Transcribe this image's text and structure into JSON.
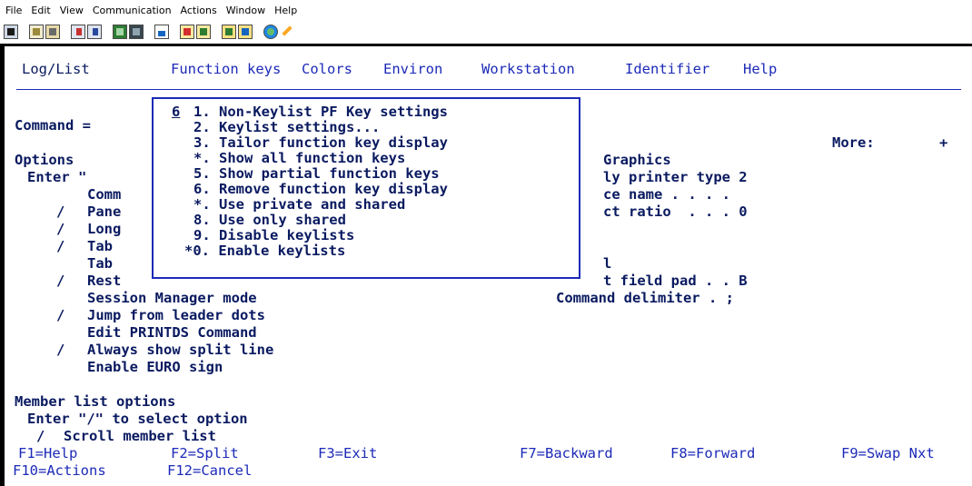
{
  "menubar": {
    "items": [
      "File",
      "Edit",
      "View",
      "Communication",
      "Actions",
      "Window",
      "Help"
    ]
  },
  "toolbar": {
    "icons": [
      "screen-icon",
      "copy-icon",
      "paste-icon",
      "send-icon",
      "receive-icon",
      "green-icon",
      "dark-icon",
      "chart-icon",
      "red-icon",
      "yellow-icon",
      "macro-record-icon",
      "macro-play-icon",
      "globe-icon",
      "pencil-icon"
    ]
  },
  "action_bar": {
    "items": [
      "Log/List",
      "Function keys",
      "Colors",
      "Environ",
      "Workstation",
      "Identifier",
      "Help"
    ]
  },
  "command_label": "Command =",
  "more_label": "More:",
  "more_indicator": "+",
  "options_label": "Options",
  "enter_partial": "Enter \"",
  "left_fragments": [
    "Comm",
    "Pane",
    "Long",
    "Tab",
    "Tab",
    "Rest"
  ],
  "left_markers": [
    "",
    "/",
    "/",
    "/",
    "",
    "/"
  ],
  "right_fragments": {
    "graphics": "Graphics",
    "printer": "ly printer type 2",
    "device": "ce name . . . .",
    "aspect": "ct ratio  . . . 0",
    "blank": "l",
    "field_pad": "t field pad . . B"
  },
  "popup": {
    "selected_value": "6",
    "items": [
      "1. Non-Keylist PF Key settings",
      "2. Keylist settings...",
      "3. Tailor function key display",
      "*. Show all function keys",
      "5. Show partial function keys",
      "6. Remove function key display",
      "*. Use private and shared",
      "8. Use only shared",
      "9. Disable keylists",
      "*0. Enable keylists"
    ]
  },
  "session_manager": "Session Manager mode",
  "command_delimiter": "Command delimiter . ;",
  "lower_options": [
    {
      "marker": "/",
      "label": "Jump from leader dots"
    },
    {
      "marker": "",
      "label": "Edit PRINTDS Command"
    },
    {
      "marker": "/",
      "label": "Always show split line"
    },
    {
      "marker": "",
      "label": "Enable EURO sign"
    }
  ],
  "member_list": {
    "title": "Member list options",
    "instruction": "Enter \"/\" to select option",
    "marker": "/",
    "option": "Scroll member list"
  },
  "function_keys_row1": [
    "F1=Help",
    "F2=Split",
    "F3=Exit",
    "F7=Backward",
    "F8=Forward",
    "F9=Swap Nxt"
  ],
  "function_keys_row2": [
    "F10=Actions",
    "F12=Cancel"
  ]
}
